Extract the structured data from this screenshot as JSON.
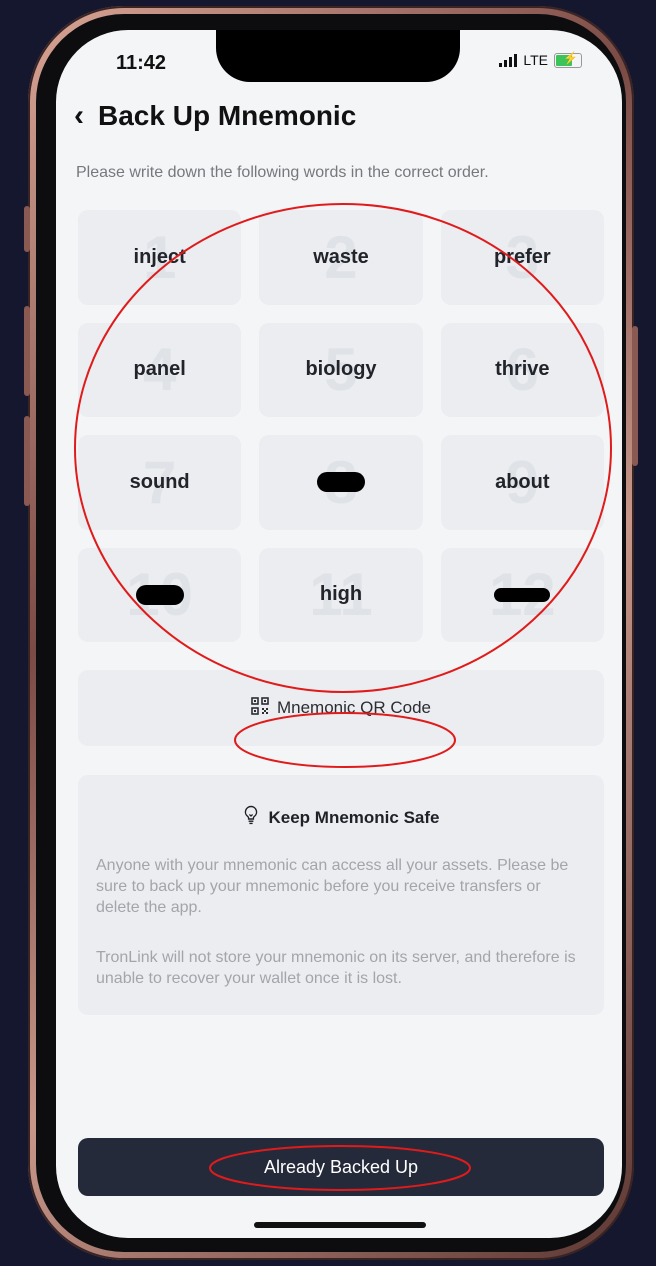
{
  "status_bar": {
    "time": "11:42",
    "network": "LTE",
    "signal_icon": "signal-bars-icon",
    "battery_icon": "battery-charging-icon"
  },
  "header": {
    "back_icon": "chevron-left-icon",
    "title": "Back Up Mnemonic"
  },
  "instruction": "Please write down the following words in the correct order.",
  "mnemonic_words": [
    {
      "number": "1",
      "word": "inject"
    },
    {
      "number": "2",
      "word": "waste"
    },
    {
      "number": "3",
      "word": "prefer"
    },
    {
      "number": "4",
      "word": "panel"
    },
    {
      "number": "5",
      "word": "biology"
    },
    {
      "number": "6",
      "word": "thrive"
    },
    {
      "number": "7",
      "word": "sound"
    },
    {
      "number": "8",
      "word": ""
    },
    {
      "number": "9",
      "word": "about"
    },
    {
      "number": "10",
      "word": ""
    },
    {
      "number": "11",
      "word": "high"
    },
    {
      "number": "12",
      "word": ""
    }
  ],
  "qr_button": {
    "icon": "qr-code-icon",
    "label": "Mnemonic QR Code"
  },
  "safety": {
    "icon": "lightbulb-icon",
    "title": "Keep Mnemonic Safe",
    "paragraph1": "Anyone with your mnemonic can access all your assets. Please be sure to back up your mnemonic before you receive transfers or delete the app.",
    "paragraph2": "TronLink will not store your mnemonic on its server, and therefore is unable to recover your wallet once it is lost."
  },
  "primary_button": {
    "label": "Already Backed Up"
  },
  "colors": {
    "annotation_red": "#e01b1b",
    "button_bg": "#252a3a",
    "screen_bg": "#f4f5f7"
  }
}
